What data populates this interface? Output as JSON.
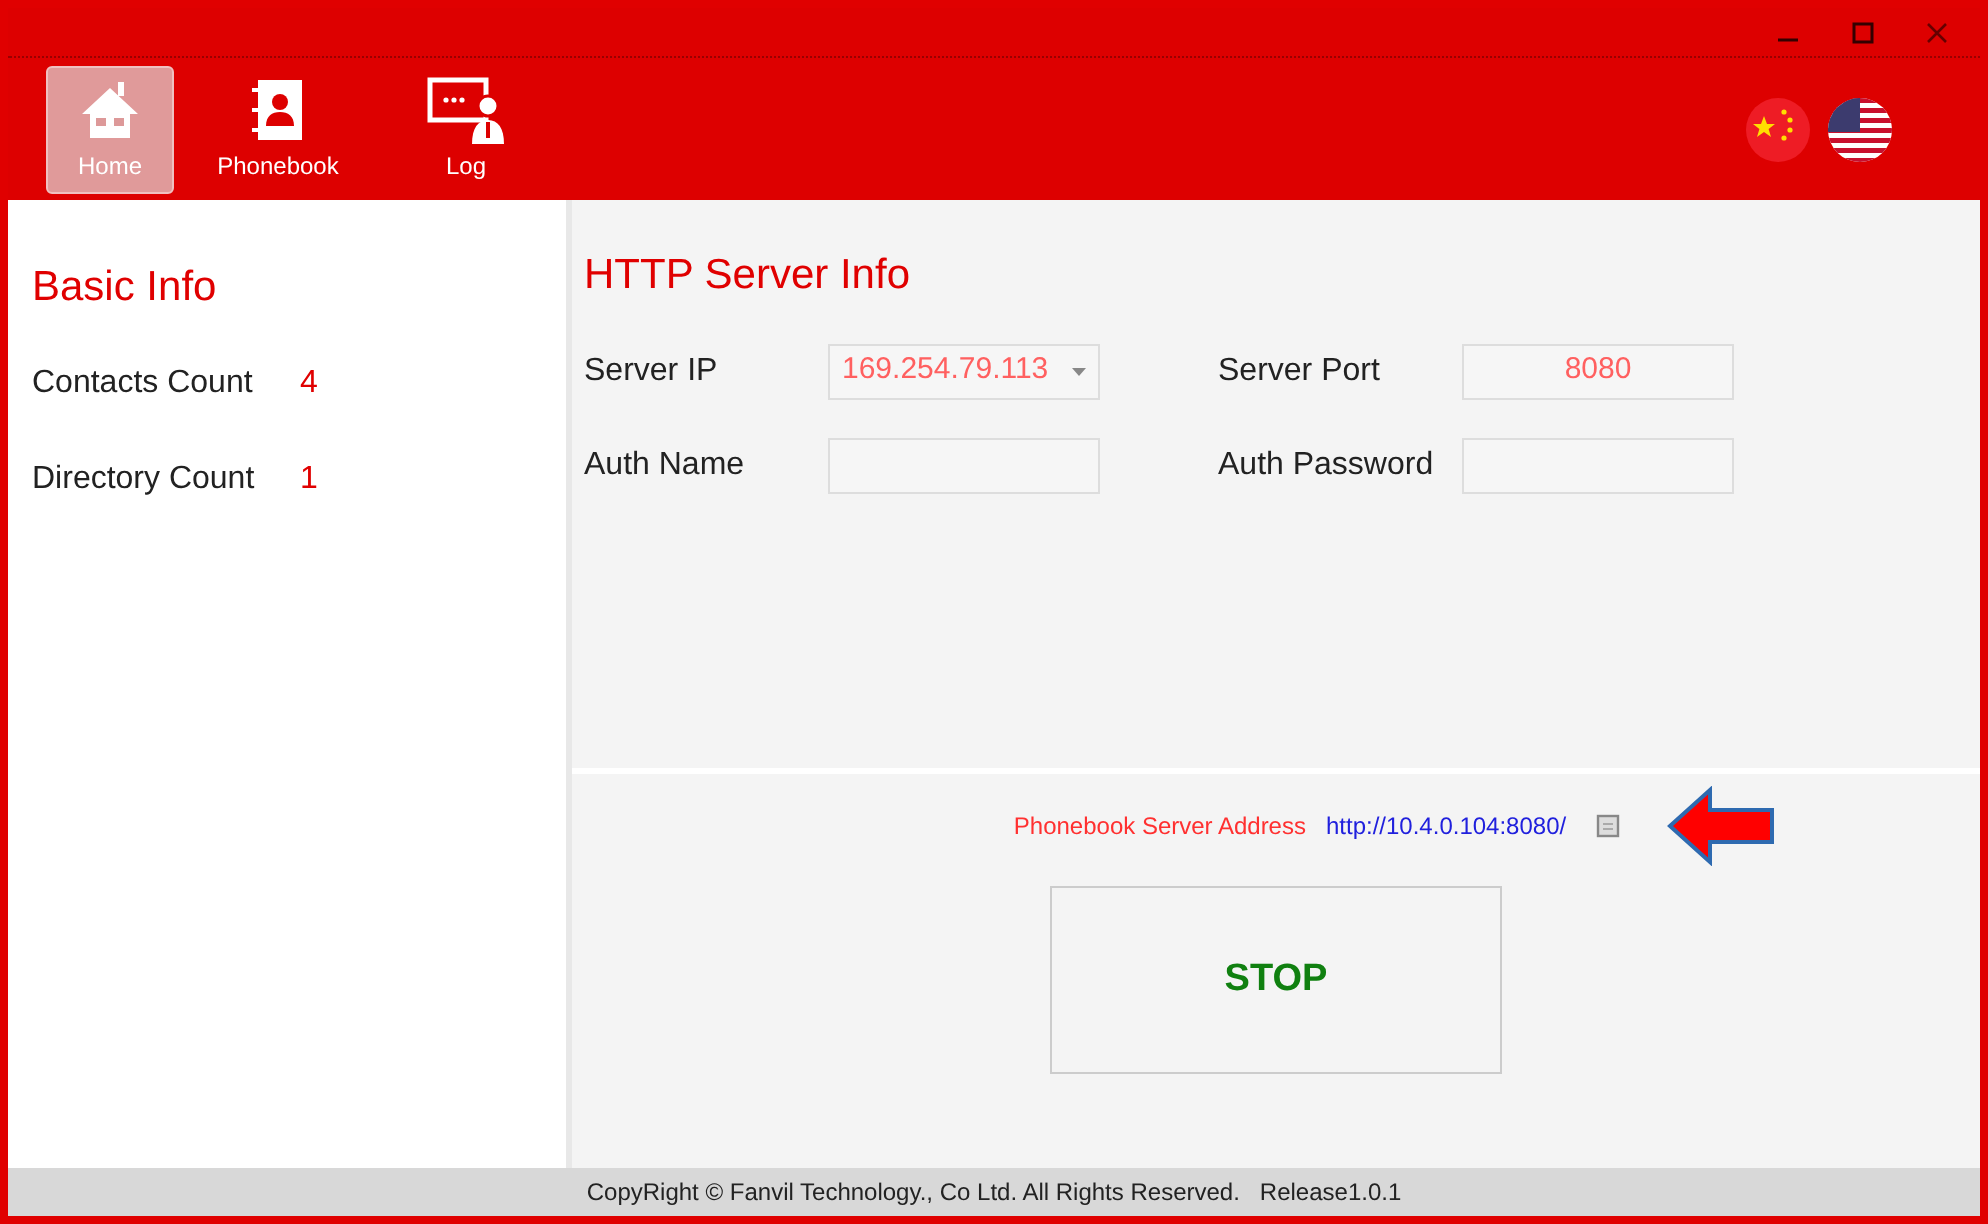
{
  "nav": [
    {
      "label": "Home",
      "selected": true
    },
    {
      "label": "Phonebook",
      "selected": false
    },
    {
      "label": "Log",
      "selected": false
    }
  ],
  "basic_info": {
    "title": "Basic Info",
    "stats": [
      {
        "label": "Contacts Count",
        "value": "4"
      },
      {
        "label": "Directory Count",
        "value": "1"
      }
    ]
  },
  "server_info": {
    "title": "HTTP Server Info",
    "fields": [
      {
        "label": "Server IP",
        "kind": "dropdown",
        "value": "169.254.79.113"
      },
      {
        "label": "Server Port",
        "kind": "text",
        "value": "8080"
      },
      {
        "label": "Auth Name",
        "kind": "text"
      },
      {
        "label": "Auth Password",
        "kind": "text"
      }
    ]
  },
  "address": {
    "label": "Phonebook Server Address",
    "url": "http://10.4.0.104:8080/"
  },
  "stop_button": "STOP",
  "footer": "CopyRight © Fanvil Technology., Co Ltd. All Rights Reserved.   Release1.0.1"
}
